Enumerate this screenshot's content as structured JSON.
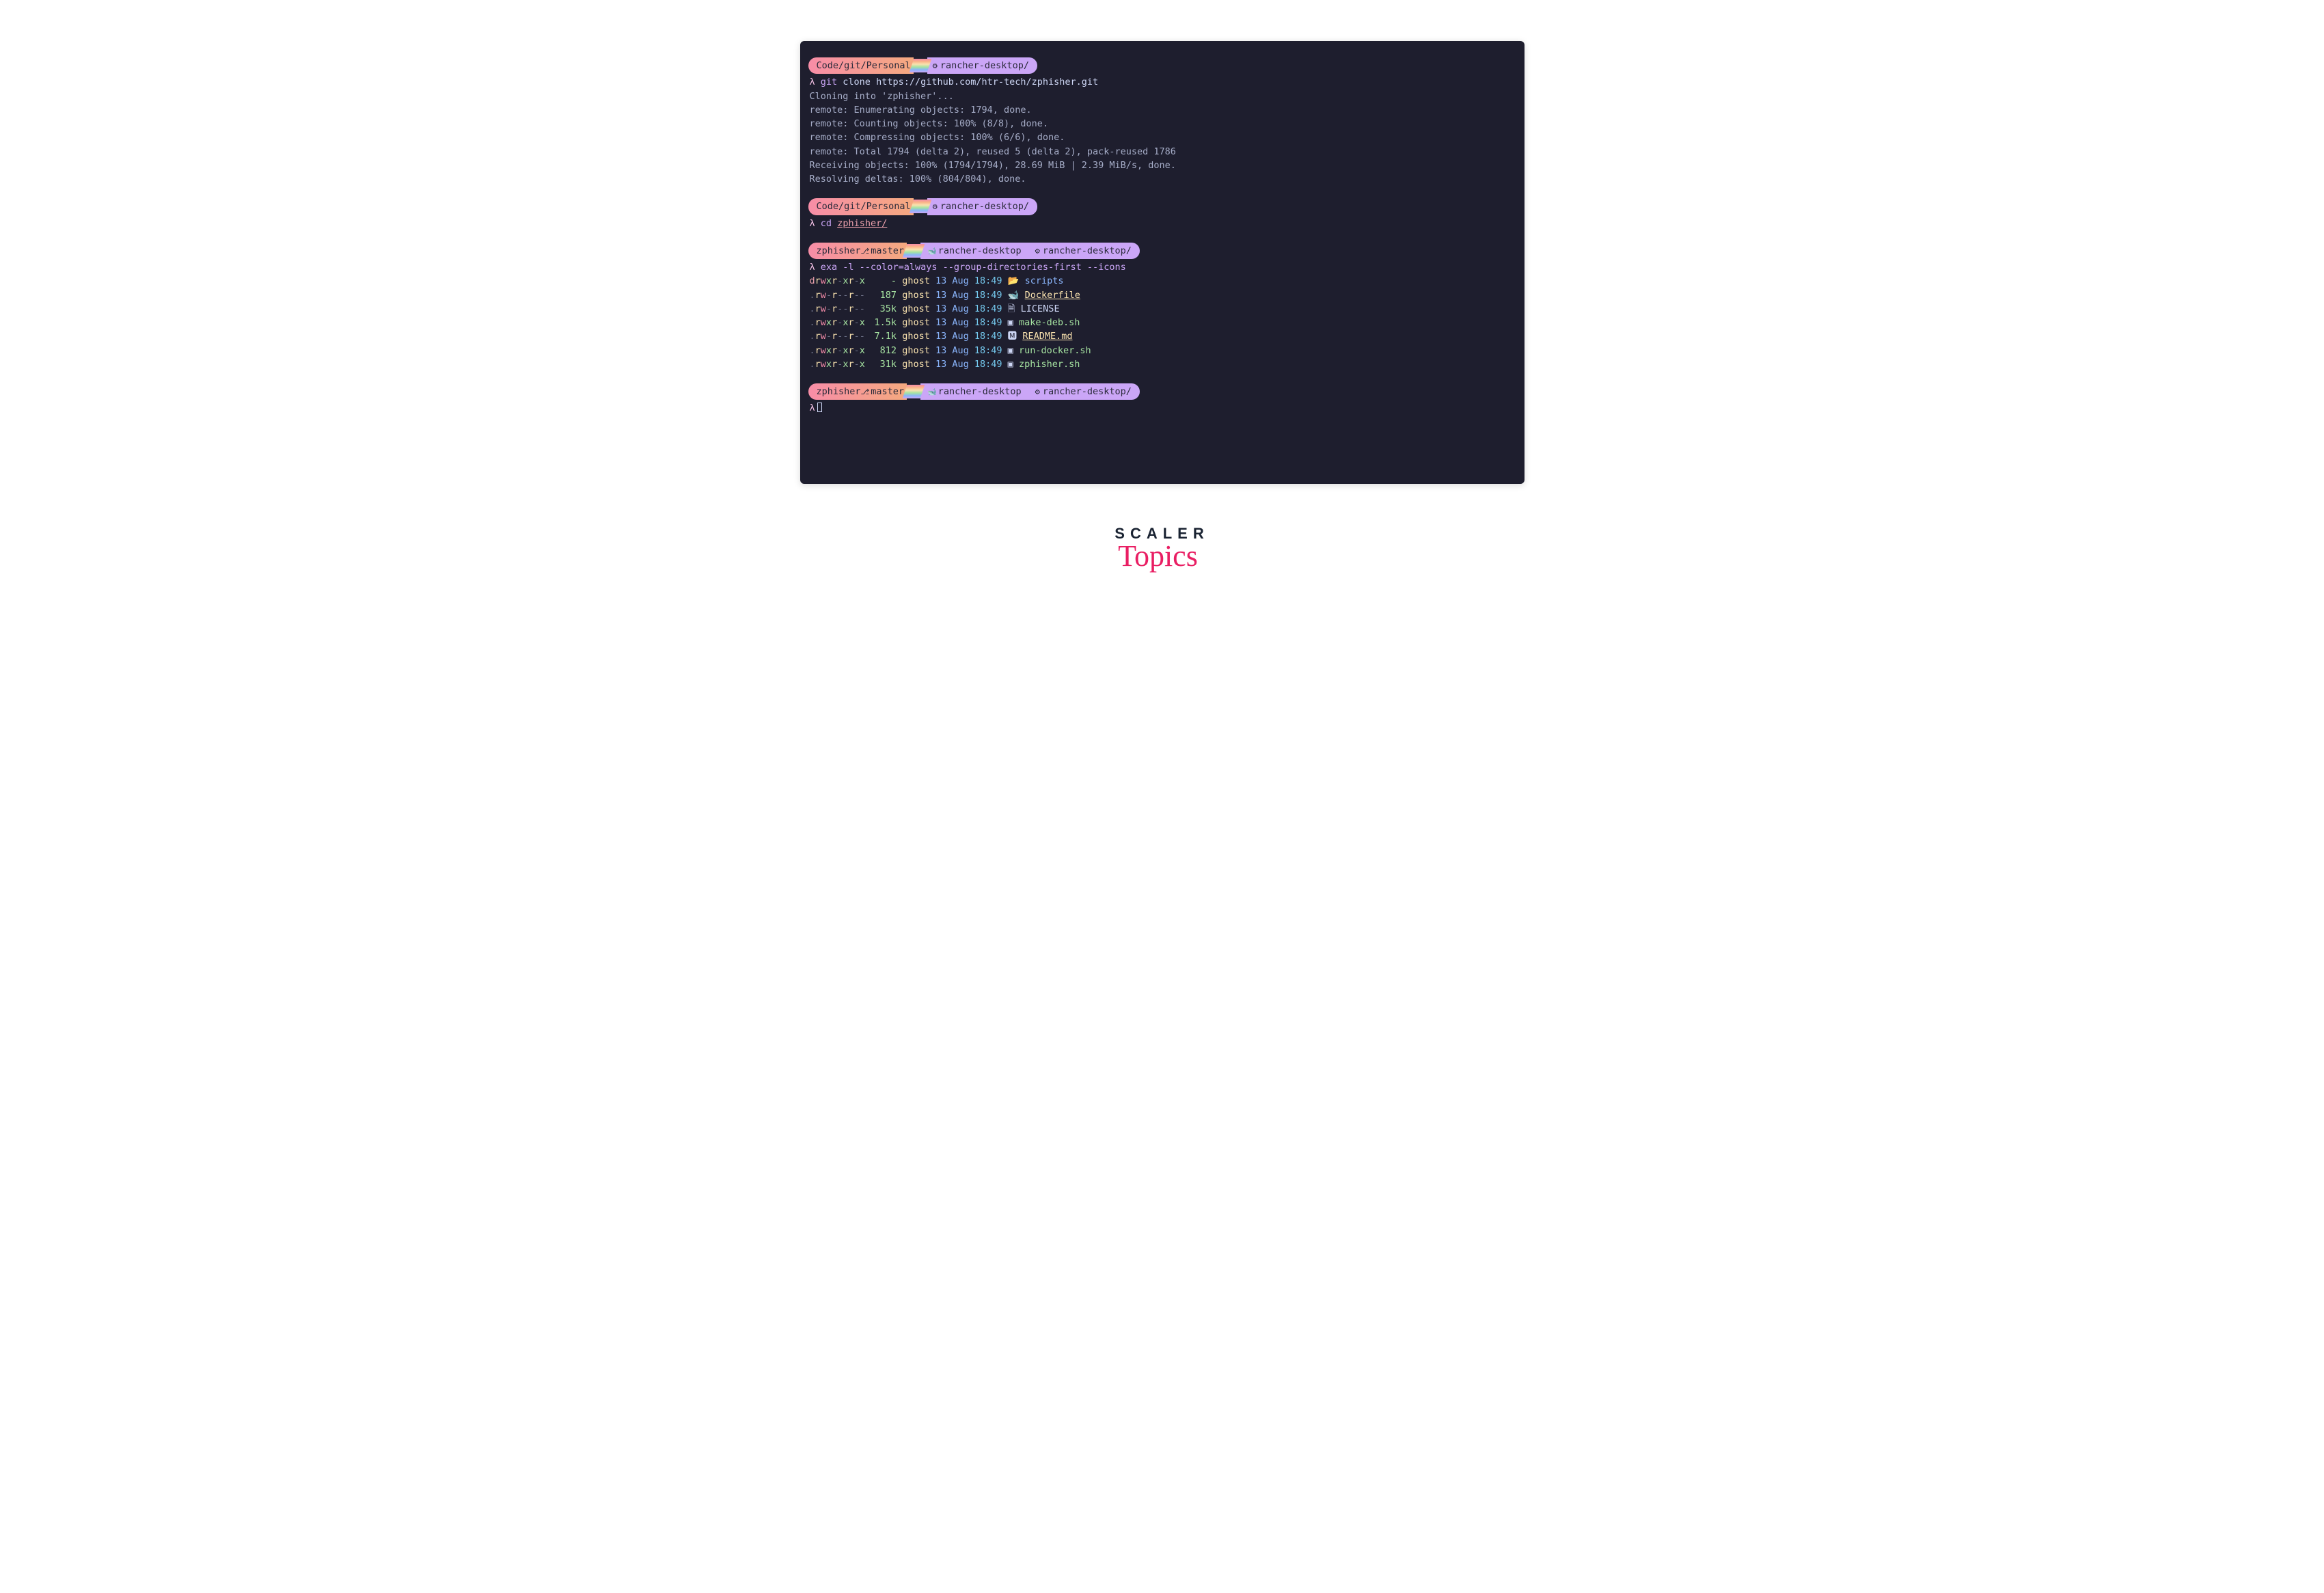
{
  "prompt_char": "λ",
  "pill1": {
    "left": "Code/git/Personal",
    "right": "rancher-desktop/",
    "icon": "gear"
  },
  "cmd1": {
    "word": "git",
    "rest": " clone https://github.com/htr-tech/zphisher.git"
  },
  "out1": [
    "Cloning into 'zphisher'...",
    "remote: Enumerating objects: 1794, done.",
    "remote: Counting objects: 100% (8/8), done.",
    "remote: Compressing objects: 100% (6/6), done.",
    "remote: Total 1794 (delta 2), reused 5 (delta 2), pack-reused 1786",
    "Receiving objects: 100% (1794/1794), 28.69 MiB | 2.39 MiB/s, done.",
    "Resolving deltas: 100% (804/804), done."
  ],
  "cmd2": {
    "word": "cd",
    "path": "zphisher/"
  },
  "pill3": {
    "left": "zphisher",
    "branch": "master",
    "mid": "rancher-desktop",
    "right": "rancher-desktop/"
  },
  "cmd3": "exa -l --color=always --group-directories-first --icons",
  "listing": [
    {
      "perm": "drwxr-xr-x",
      "size": "-",
      "owner": "ghost",
      "date": "13 Aug",
      "time": "18:49",
      "icon": "folder",
      "name": "scripts",
      "cls": "dirname"
    },
    {
      "perm": ".rw-r--r--",
      "size": "187",
      "owner": "ghost",
      "date": "13 Aug",
      "time": "18:49",
      "icon": "whale",
      "name": "Dockerfile",
      "cls": "linkfile"
    },
    {
      "perm": ".rw-r--r--",
      "size": "35k",
      "owner": "ghost",
      "date": "13 Aug",
      "time": "18:49",
      "icon": "file",
      "name": "LICENSE",
      "cls": "filename"
    },
    {
      "perm": ".rwxr-xr-x",
      "size": "1.5k",
      "owner": "ghost",
      "date": "13 Aug",
      "time": "18:49",
      "icon": "sh",
      "name": "make-deb.sh",
      "cls": "exec"
    },
    {
      "perm": ".rw-r--r--",
      "size": "7.1k",
      "owner": "ghost",
      "date": "13 Aug",
      "time": "18:49",
      "icon": "md",
      "name": "README.md",
      "cls": "linkfile"
    },
    {
      "perm": ".rwxr-xr-x",
      "size": "812",
      "owner": "ghost",
      "date": "13 Aug",
      "time": "18:49",
      "icon": "sh",
      "name": "run-docker.sh",
      "cls": "exec"
    },
    {
      "perm": ".rwxr-xr-x",
      "size": "31k",
      "owner": "ghost",
      "date": "13 Aug",
      "time": "18:49",
      "icon": "sh",
      "name": "zphisher.sh",
      "cls": "exec"
    }
  ],
  "brand": {
    "top": "SCALER",
    "bottom": "Topics"
  }
}
